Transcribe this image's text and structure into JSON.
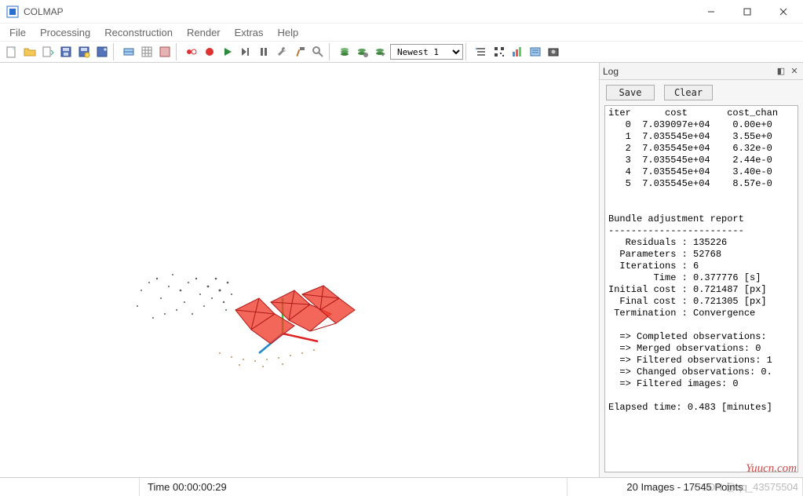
{
  "window": {
    "title": "COLMAP"
  },
  "menu": {
    "items": [
      "File",
      "Processing",
      "Reconstruction",
      "Render",
      "Extras",
      "Help"
    ]
  },
  "toolbar": {
    "combo_value": "Newest 1",
    "icons": [
      "new-project",
      "open-project",
      "import-project",
      "save",
      "save-as",
      "export",
      "auto-reconstruct",
      "image-list",
      "match-matrix",
      "feature-extract",
      "run",
      "play",
      "next-frame",
      "pause",
      "settings-wrench",
      "settings-hammer",
      "bundle-adjust",
      "dense-fuse",
      "dense-stereo",
      "dense-mesh",
      "combo",
      "textured-mesh",
      "stats",
      "chart",
      "movie",
      "grab"
    ]
  },
  "log": {
    "title": "Log",
    "save_label": "Save",
    "clear_label": "Clear",
    "text": "iter      cost       cost_chan\n   0  7.039097e+04    0.00e+0\n   1  7.035545e+04    3.55e+0\n   2  7.035545e+04    6.32e-0\n   3  7.035545e+04    2.44e-0\n   4  7.035545e+04    3.40e-0\n   5  7.035545e+04    8.57e-0\n\n\nBundle adjustment report\n------------------------\n   Residuals : 135226\n  Parameters : 52768\n  Iterations : 6\n        Time : 0.377776 [s]\nInitial cost : 0.721487 [px]\n  Final cost : 0.721305 [px]\n Termination : Convergence\n\n  => Completed observations:\n  => Merged observations: 0\n  => Filtered observations: 1\n  => Changed observations: 0.\n  => Filtered images: 0\n\nElapsed time: 0.483 [minutes]"
  },
  "status": {
    "time": "Time 00:00:00:29",
    "info": "20 Images - 17545 Points"
  },
  "watermark": {
    "site": "Yuucn.com",
    "author": "CSDN @qq_43575504"
  }
}
